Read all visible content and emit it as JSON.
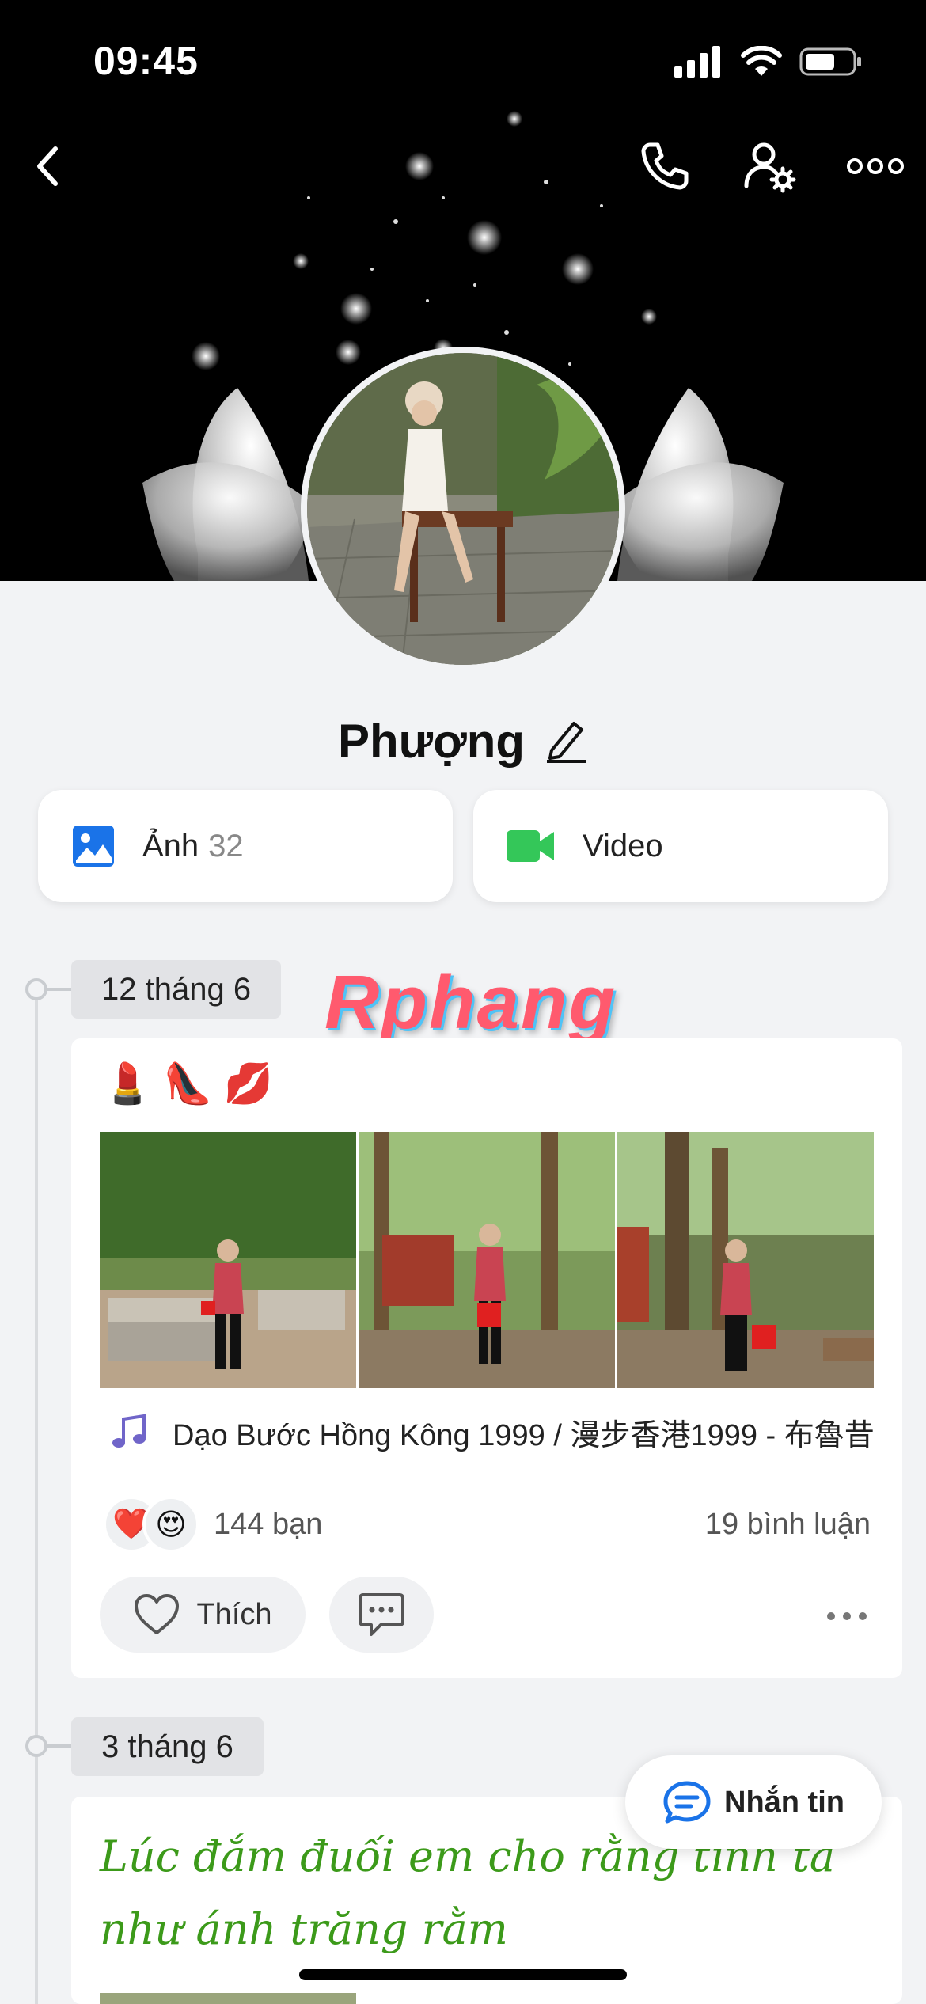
{
  "status_bar": {
    "time": "09:45"
  },
  "profile": {
    "name": "Phượng"
  },
  "media": {
    "photos_label": "Ảnh",
    "photos_count": "32",
    "video_label": "Video"
  },
  "watermark": "Rphang",
  "posts": [
    {
      "date": "12 tháng 6",
      "caption_emojis": [
        "💄",
        "👠",
        "💋"
      ],
      "music": "Dạo Bước Hồng Kông 1999 / 漫步香港1999 - 布魯昔",
      "reactions": [
        "❤️",
        "😍"
      ],
      "reaction_count": "144 bạn",
      "comment_count": "19 bình luận",
      "like_label": "Thích"
    },
    {
      "date": "3 tháng 6",
      "text": "Lúc đắm đuối em cho rằng tình ta như ánh trăng rằm"
    }
  ],
  "message_button": "Nhắn tin",
  "colors": {
    "accent_blue": "#1a73e8",
    "video_green": "#34c759",
    "quote_green": "#3c9a1a",
    "background": "#f2f3f5"
  },
  "icons": [
    "back-icon",
    "phone-icon",
    "user-settings-icon",
    "more-icon",
    "image-icon",
    "video-icon",
    "music-note-icon",
    "heart-icon",
    "comment-icon",
    "message-icon"
  ]
}
